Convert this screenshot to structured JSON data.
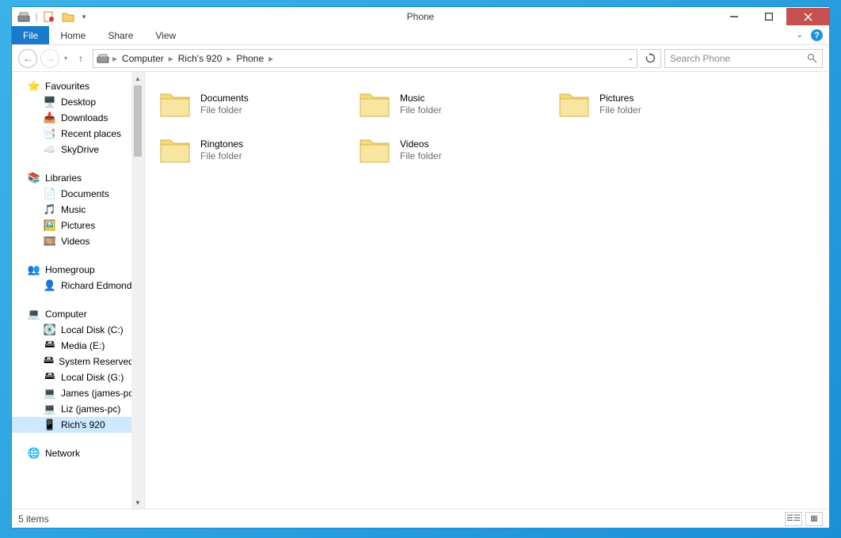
{
  "window": {
    "title": "Phone"
  },
  "qat": {
    "drive_glyph": "🖴",
    "doc_glyph": "📄",
    "folder_glyph": "📁"
  },
  "ribbon": {
    "file": "File",
    "tabs": [
      "Home",
      "Share",
      "View"
    ]
  },
  "address": {
    "segments": [
      "Computer",
      "Rich's 920",
      "Phone"
    ]
  },
  "search": {
    "placeholder": "Search Phone"
  },
  "nav": {
    "favourites": {
      "label": "Favourites",
      "items": [
        {
          "label": "Desktop",
          "glyph": "🖥️"
        },
        {
          "label": "Downloads",
          "glyph": "📥"
        },
        {
          "label": "Recent places",
          "glyph": "📑"
        },
        {
          "label": "SkyDrive",
          "glyph": "☁️"
        }
      ]
    },
    "libraries": {
      "label": "Libraries",
      "items": [
        {
          "label": "Documents",
          "glyph": "📄"
        },
        {
          "label": "Music",
          "glyph": "🎵"
        },
        {
          "label": "Pictures",
          "glyph": "🖼️"
        },
        {
          "label": "Videos",
          "glyph": "🎞️"
        }
      ]
    },
    "homegroup": {
      "label": "Homegroup",
      "items": [
        {
          "label": "Richard Edmond",
          "glyph": "👤"
        }
      ]
    },
    "computer": {
      "label": "Computer",
      "items": [
        {
          "label": "Local Disk (C:)",
          "glyph": "💽"
        },
        {
          "label": "Media (E:)",
          "glyph": "🖴"
        },
        {
          "label": "System Reserved",
          "glyph": "🖴"
        },
        {
          "label": "Local Disk (G:)",
          "glyph": "🖴"
        },
        {
          "label": "James (james-pc)",
          "glyph": "💻"
        },
        {
          "label": "Liz (james-pc)",
          "glyph": "💻"
        },
        {
          "label": "Rich's 920",
          "glyph": "📱",
          "selected": true
        }
      ]
    },
    "network": {
      "label": "Network"
    }
  },
  "items": [
    {
      "name": "Documents",
      "type": "File folder"
    },
    {
      "name": "Music",
      "type": "File folder"
    },
    {
      "name": "Pictures",
      "type": "File folder"
    },
    {
      "name": "Ringtones",
      "type": "File folder"
    },
    {
      "name": "Videos",
      "type": "File folder"
    }
  ],
  "status": {
    "text": "5 items"
  }
}
